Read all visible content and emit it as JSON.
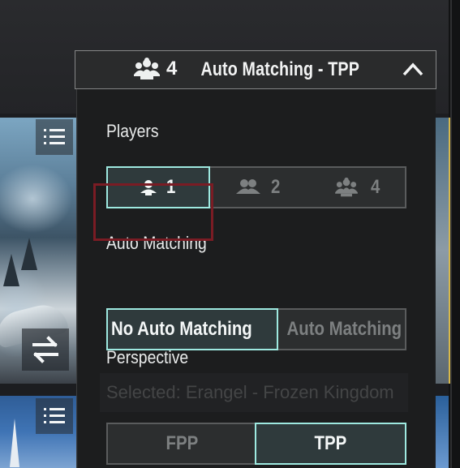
{
  "header": {
    "squad_count": "4",
    "title": "Auto Matching - TPP",
    "icon": "squad-icon",
    "toggle_icon": "chevron-up-icon"
  },
  "players": {
    "label": "Players",
    "options": [
      {
        "value": "1",
        "icon": "solo-icon",
        "selected": true
      },
      {
        "value": "2",
        "icon": "duo-icon",
        "selected": false
      },
      {
        "value": "4",
        "icon": "squad-icon",
        "selected": false
      }
    ]
  },
  "auto_matching": {
    "label": "Auto Matching",
    "options": [
      {
        "text": "No Auto Matching",
        "selected": true
      },
      {
        "text": "Auto Matching",
        "selected": false
      }
    ]
  },
  "background_text": "Selected: Erangel - Frozen Kingdom",
  "perspective": {
    "label": "Perspective",
    "options": [
      {
        "text": "FPP",
        "selected": false
      },
      {
        "text": "TPP",
        "selected": true
      }
    ]
  },
  "colors": {
    "accent": "#9ee9e0",
    "highlight": "#7a1c24",
    "panel_bg": "#1c1d1e",
    "inactive_text": "#7d8081"
  }
}
